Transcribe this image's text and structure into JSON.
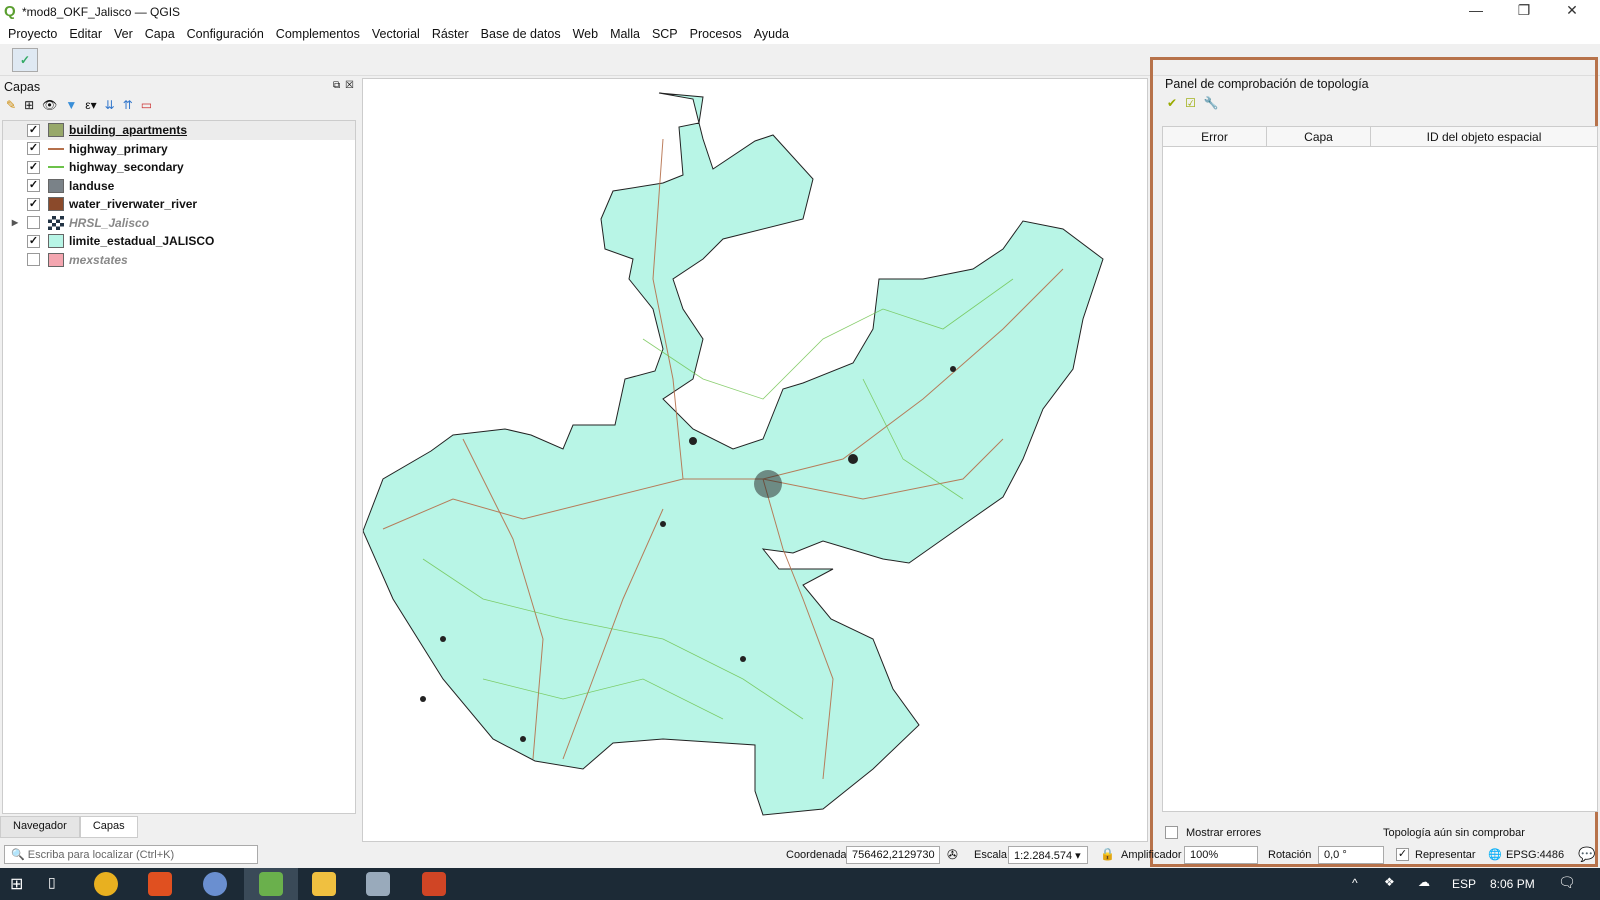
{
  "window": {
    "title": "*mod8_OKF_Jalisco — QGIS",
    "minimize": "—",
    "restore": "❐",
    "close": "✕"
  },
  "menu": [
    "Proyecto",
    "Editar",
    "Ver",
    "Capa",
    "Configuración",
    "Complementos",
    "Vectorial",
    "Ráster",
    "Base de datos",
    "Web",
    "Malla",
    "SCP",
    "Procesos",
    "Ayuda"
  ],
  "layers_panel": {
    "title": "Capas",
    "items": [
      {
        "name": "building_apartments",
        "checked": true,
        "symbol": "fill",
        "color": "#97a86a",
        "active": true
      },
      {
        "name": "highway_primary",
        "checked": true,
        "symbol": "line",
        "color": "#b5704b"
      },
      {
        "name": "highway_secondary",
        "checked": true,
        "symbol": "line",
        "color": "#6cc24a"
      },
      {
        "name": "landuse",
        "checked": true,
        "symbol": "fill",
        "color": "#7a8288"
      },
      {
        "name": "water_riverwater_river",
        "checked": true,
        "symbol": "fill",
        "color": "#8b4a2b"
      },
      {
        "name": "HRSL_Jalisco",
        "checked": false,
        "symbol": "raster",
        "color": "#223344",
        "disabled": true,
        "expandable": true
      },
      {
        "name": "limite_estadual_JALISCO",
        "checked": true,
        "symbol": "fill",
        "color": "#b8f5e6"
      },
      {
        "name": "mexstates",
        "checked": false,
        "symbol": "fill",
        "color": "#f4a6b0",
        "disabled": true
      }
    ]
  },
  "bottom_tabs": [
    "Navegador",
    "Capas"
  ],
  "locator": {
    "placeholder": "Escriba para localizar (Ctrl+K)"
  },
  "topology": {
    "title": "Panel de comprobación de topología",
    "columns": [
      "Error",
      "Capa",
      "ID del objeto espacial"
    ],
    "show_errors": "Mostrar errores",
    "status": "Topología aún sin comprobar"
  },
  "status": {
    "coord_label": "Coordenada",
    "coord": "756462,2129730",
    "scale_label": "Escala",
    "scale": "1:2.284.574",
    "magnifier_label": "Amplificador",
    "magnifier": "100%",
    "rotation_label": "Rotación",
    "rotation": "0,0 °",
    "render_label": "Representar",
    "crs": "EPSG:4486"
  },
  "taskbar": {
    "lang": "ESP",
    "time": "8:06 PM"
  },
  "colors": {
    "accent_border": "#b7724a",
    "map_fill": "#b8f5e6"
  }
}
